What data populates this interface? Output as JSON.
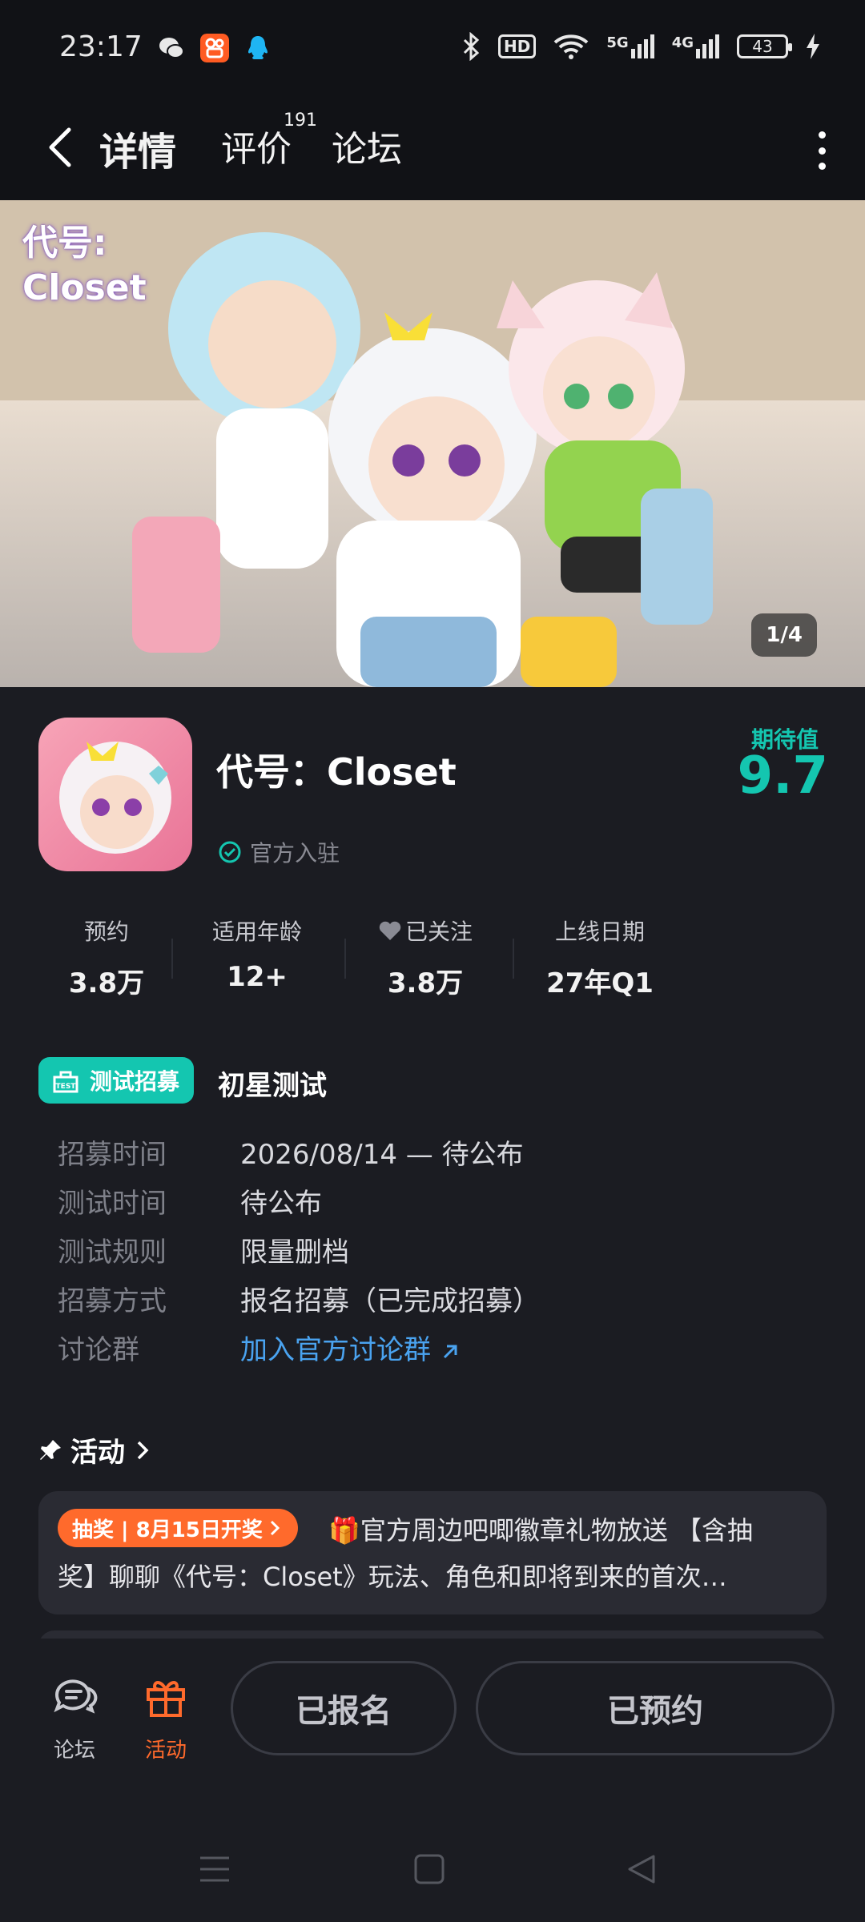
{
  "status_bar": {
    "time": "23:17",
    "hd_label": "HD",
    "net1": "5G",
    "net2": "4G",
    "battery": "43"
  },
  "nav": {
    "tab_detail": "详情",
    "tab_review": "评价",
    "review_count": "191",
    "tab_forum": "论坛"
  },
  "banner": {
    "logo_line1": "代号:",
    "logo_line2": "Closet",
    "counter": "1/4"
  },
  "game": {
    "title": "代号：Closet",
    "verified": "官方入驻",
    "expect_label": "期待值",
    "expect_score": "9.7"
  },
  "stats": [
    {
      "label": "预约",
      "value": "3.8万"
    },
    {
      "label": "适用年龄",
      "value": "12+"
    },
    {
      "label": "已关注",
      "value": "3.8万"
    },
    {
      "label": "上线日期",
      "value": "27年Q1"
    }
  ],
  "test": {
    "badge": "测试招募",
    "badge_icon_text": "TEST",
    "name": "初星测试",
    "rows": [
      {
        "key": "招募时间",
        "value": "2026/08/14 — 待公布"
      },
      {
        "key": "测试时间",
        "value": "待公布"
      },
      {
        "key": "测试规则",
        "value": "限量删档"
      },
      {
        "key": "招募方式",
        "value": "报名招募（已完成招募）"
      },
      {
        "key": "讨论群",
        "value": "加入官方讨论群"
      }
    ]
  },
  "activity": {
    "heading": "活动",
    "tag": "抽奖 | 8月15日开奖",
    "line1": "🎁官方周边吧唧徽章礼物放送 【含抽",
    "line2": "奖】聊聊《代号：Closet》玩法、角色和即将到来的首次…"
  },
  "bottom": {
    "forum_label": "论坛",
    "activity_label": "活动",
    "signed_up": "已报名",
    "reserved": "已预约"
  },
  "colors": {
    "accent": "#14c6b0",
    "background": "#1b1c22",
    "orange": "#ff6a2c",
    "link": "#4aa3f0"
  }
}
